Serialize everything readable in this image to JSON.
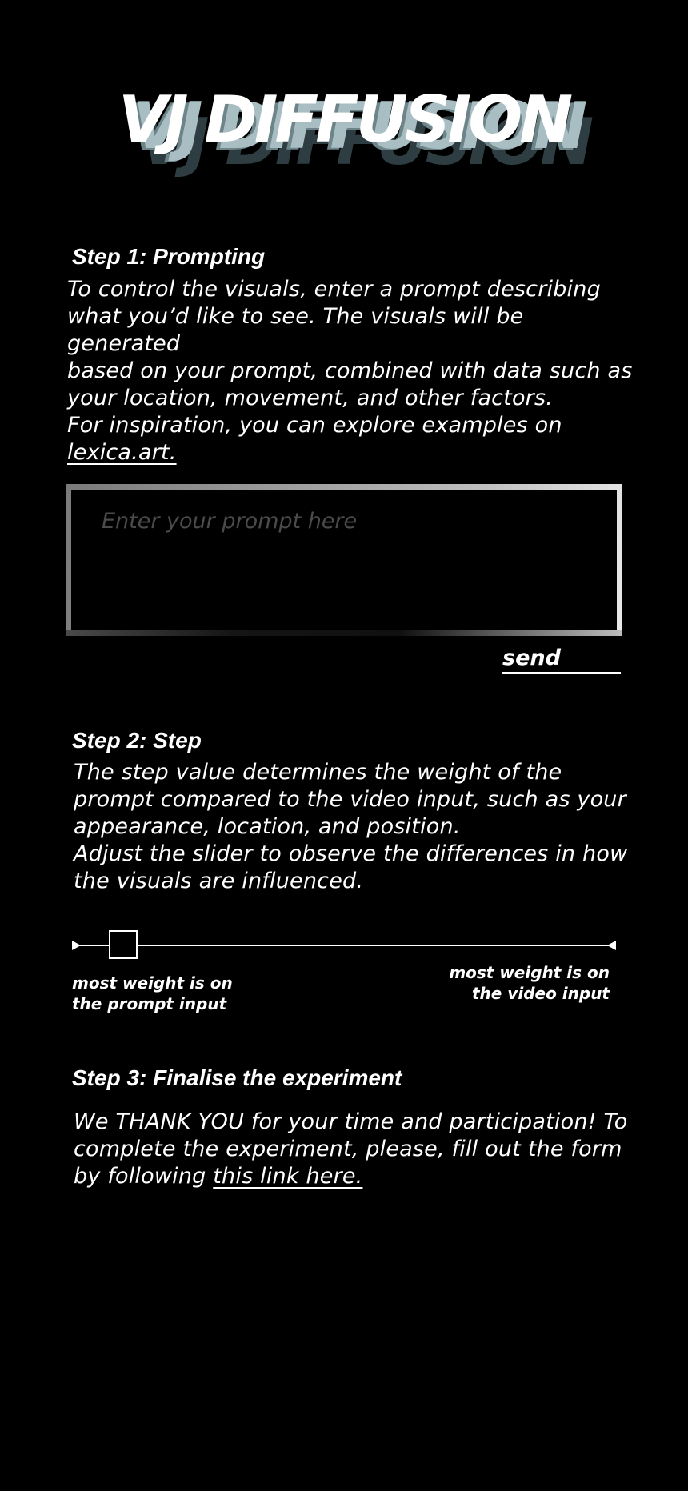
{
  "logo": {
    "text": "VJ DIFFUSION",
    "colors": [
      "#ffffff",
      "#a9bec3",
      "#6d8489",
      "#2e3d41"
    ]
  },
  "step1": {
    "title": "Step 1: Prompting",
    "description_lines": [
      "To control the visuals, enter a prompt describing",
      "what you’d like to see. The visuals will be generated",
      "based on your prompt, combined with data such as",
      "your location, movement, and other factors."
    ],
    "inspiration_text": "For inspiration, you can explore examples on",
    "inspiration_link": "lexica.art.",
    "prompt_placeholder": "Enter your prompt here",
    "prompt_value": "",
    "send_label": "send"
  },
  "step2": {
    "title": "Step 2: Step",
    "description_lines": [
      "The step value determines the weight of the",
      "prompt compared to the video input, such as your",
      "appearance, location, and position.",
      "Adjust the slider to observe the differences in how",
      "the visuals are influenced."
    ],
    "slider": {
      "value_fraction": 0.06,
      "left_label_lines": [
        "most weight is on",
        "the prompt input"
      ],
      "right_label_lines": [
        "most weight is on",
        "the video input"
      ]
    }
  },
  "step3": {
    "title": "Step 3: Finalise the experiment",
    "description_lines": [
      "We THANK YOU for your time and participation! To",
      "complete the experiment, please, fill out the form"
    ],
    "last_line_prefix": "by following ",
    "link_text": "this link here."
  }
}
